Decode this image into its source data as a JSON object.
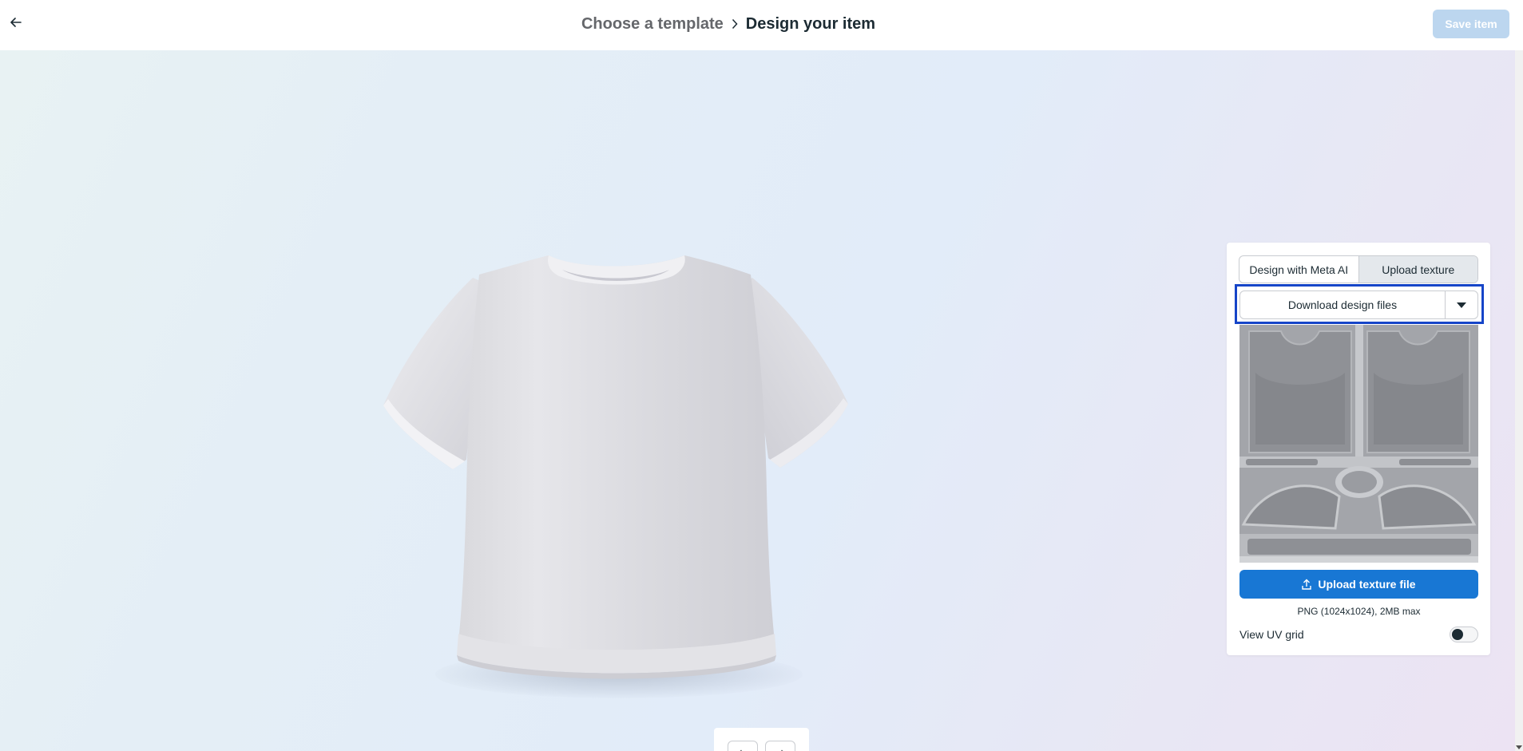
{
  "header": {
    "back_icon": "arrow-left-icon",
    "breadcrumb": {
      "previous": "Choose a template",
      "separator_icon": "chevron-right-icon",
      "current": "Design your item"
    },
    "save_label": "Save item"
  },
  "canvas": {
    "model": "t-shirt",
    "undo_icon": "undo-icon",
    "redo_icon": "redo-icon"
  },
  "panel": {
    "tabs": [
      {
        "label": "Design with Meta AI",
        "active": false
      },
      {
        "label": "Upload texture",
        "active": true
      }
    ],
    "download_label": "Download design files",
    "download_dropdown_icon": "caret-down-icon",
    "upload_label": "Upload texture file",
    "upload_icon": "upload-icon",
    "upload_hint": "PNG (1024x1024), 2MB max",
    "uv_grid_label": "View UV grid",
    "uv_grid_on": false
  },
  "colors": {
    "accent": "#1877d4",
    "highlight_outline": "#1645c8",
    "save_disabled": "#bcd6ef"
  }
}
